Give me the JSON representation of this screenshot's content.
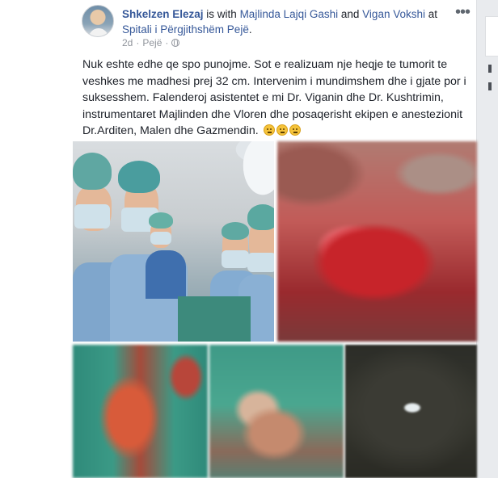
{
  "post": {
    "author": "Shkelzen Elezaj",
    "with_text": " is with ",
    "tag1": "Majlinda Lajqi Gashi",
    "and_text": " and ",
    "tag2": "Vigan Vokshi",
    "at_text": " at ",
    "place": "Spitali i Përgjithshëm Pejë",
    "period": ".",
    "time": "2d",
    "dot": "·",
    "location": "Pejë",
    "more_label": "•••",
    "text": "Nuk eshte edhe qe spo punojme. Sot e realizuam nje heqje te tumorit te veshkes me madhesi prej 32 cm. Intervenim i mundimshem dhe i gjate por i suksesshem. Falenderoj asistentet e mi Dr. Viganin dhe Dr. Kushtrimin, instrumentaret Majlinden dhe Vloren dhe posaqerisht ekipen e anestezionit Dr.Arditen, Malen dhe Gazmendin."
  },
  "icons": {
    "globe": "globe-icon",
    "more": "more-options-icon",
    "emoji": "confused-face-emoji"
  },
  "colors": {
    "link": "#365899",
    "text": "#1d2129",
    "meta": "#90949c",
    "background": "#e9ebee"
  }
}
